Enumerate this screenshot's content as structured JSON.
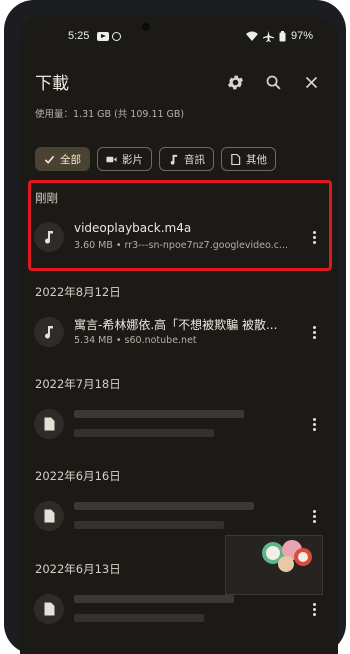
{
  "status_bar": {
    "time": "5:25",
    "battery": "97%"
  },
  "app_bar": {
    "title": "下載",
    "settings_icon": "gear-icon",
    "search_icon": "search-icon",
    "close_icon": "close-icon"
  },
  "storage": {
    "usage_text": "使用量：1.31 GB (共 109.11 GB)"
  },
  "filters": [
    {
      "label": "全部",
      "icon": "check-icon",
      "selected": true
    },
    {
      "label": "影片",
      "icon": "video-icon",
      "selected": false
    },
    {
      "label": "音訊",
      "icon": "music-icon",
      "selected": false
    },
    {
      "label": "其他",
      "icon": "document-icon",
      "selected": false
    }
  ],
  "sections": [
    {
      "header": "剛剛",
      "items": [
        {
          "name": "videoplayback.m4a",
          "meta": "3.60 MB • rr3---sn-npoe7nz7.googlevideo.c...",
          "icon": "music-note-icon"
        }
      ]
    },
    {
      "header": "2022年8月12日",
      "items": [
        {
          "name": "寓言-希林娜依.高「不想被欺騙 被散...",
          "meta": "5.34 MB • s60.notube.net",
          "icon": "music-note-icon"
        }
      ]
    },
    {
      "header": "2022年7月18日",
      "items": [
        {
          "name": "",
          "meta": "",
          "icon": "document-icon"
        }
      ]
    },
    {
      "header": "2022年6月16日",
      "items": [
        {
          "name": "",
          "meta": "",
          "icon": "document-icon"
        }
      ]
    },
    {
      "header": "2022年6月13日",
      "items": [
        {
          "name": "",
          "meta": "",
          "icon": "document-icon"
        }
      ]
    }
  ],
  "colors": {
    "background": "#1b1a17",
    "highlight_border": "#e0191f",
    "selected_chip": "#4a4331"
  }
}
